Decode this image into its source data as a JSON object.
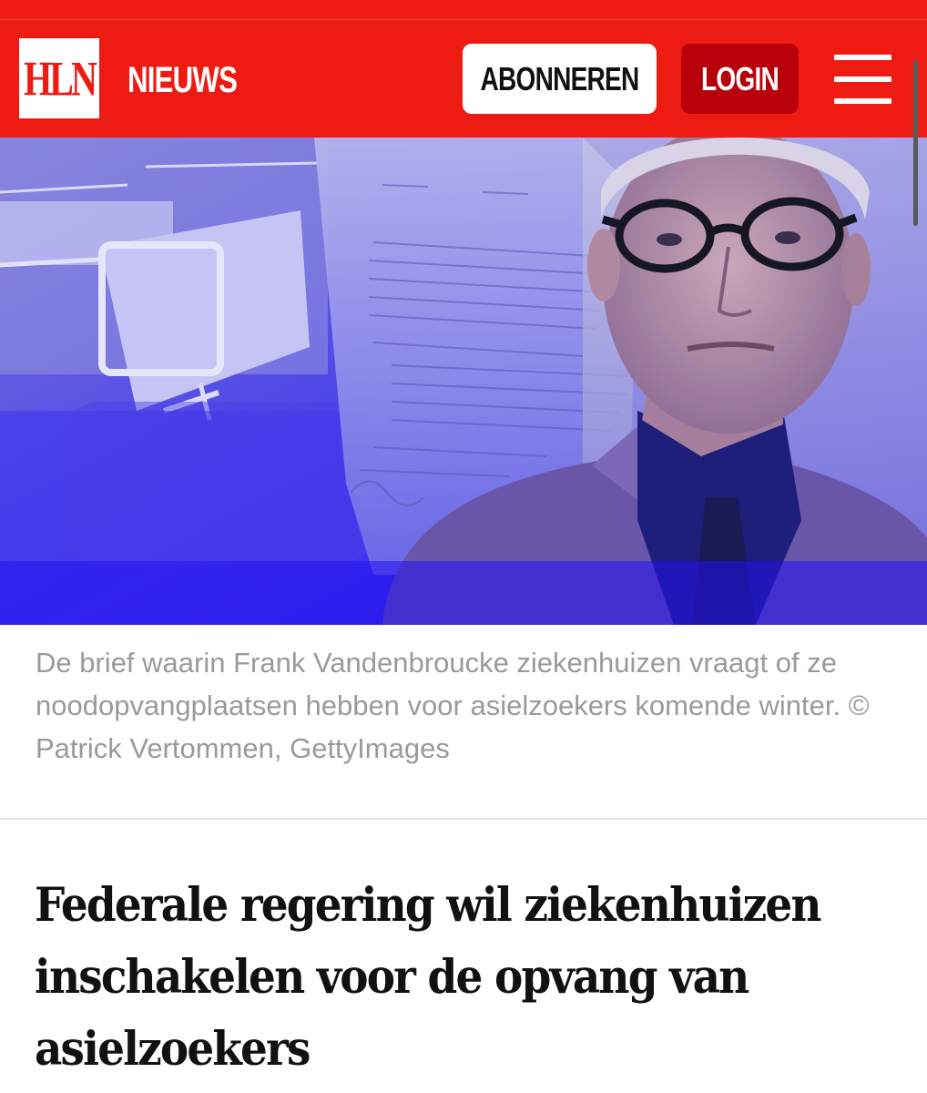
{
  "header": {
    "logo_text": "HLN",
    "section_title": "NIEUWS",
    "subscribe_label": "ABONNEREN",
    "login_label": "LOGIN",
    "menu_icon": "hamburger-menu-icon"
  },
  "colors": {
    "brand_red": "#ee1b13",
    "login_red": "#b8000a",
    "caption_gray": "#9a9a9a",
    "headline": "#111111"
  },
  "article": {
    "caption": "De brief waarin Frank Vandenbroucke ziekenhuizen vraagt of ze noodopvangplaatsen hebben voor asielzoekers komende winter. © Patrick Vertommen, GettyImages",
    "headline": "Federale regering wil ziekenhuizen inschakelen voor de opvang van asielzoekers"
  }
}
